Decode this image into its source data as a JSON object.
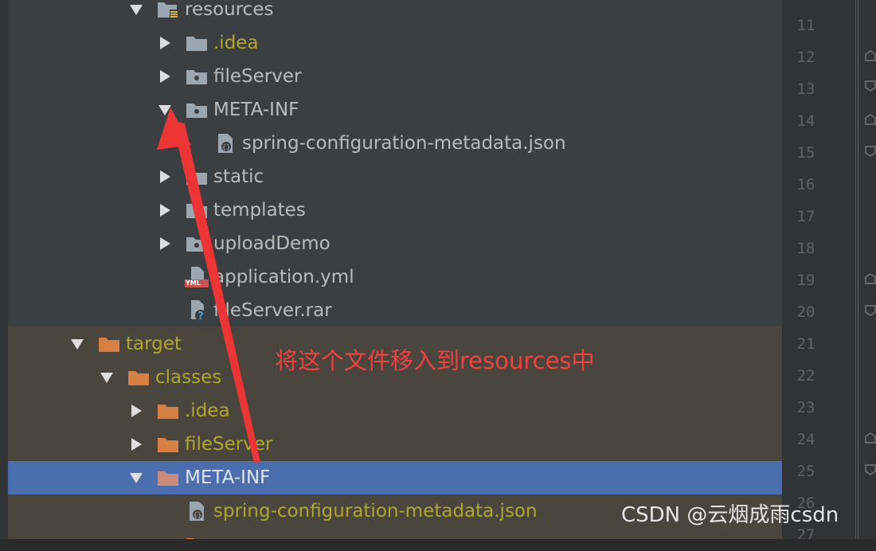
{
  "tree": {
    "items": [
      {
        "label": "resources",
        "color": "white",
        "expanded": true,
        "icon": "resources-folder-icon"
      },
      {
        "label": ".idea",
        "color": "yellow",
        "expanded": false,
        "icon": "folder-icon"
      },
      {
        "label": "fileServer",
        "color": "white",
        "expanded": false,
        "icon": "package-folder-icon"
      },
      {
        "label": "META-INF",
        "color": "white",
        "expanded": true,
        "icon": "package-folder-icon"
      },
      {
        "label": "spring-configuration-metadata.json",
        "color": "white",
        "icon": "json-file-icon"
      },
      {
        "label": "static",
        "color": "white",
        "expanded": false,
        "icon": "folder-icon"
      },
      {
        "label": "templates",
        "color": "white",
        "expanded": false,
        "icon": "folder-icon"
      },
      {
        "label": "uploadDemo",
        "color": "white",
        "expanded": false,
        "icon": "package-folder-icon"
      },
      {
        "label": "application.yml",
        "color": "white",
        "icon": "yml-file-icon",
        "icon_text": "YML"
      },
      {
        "label": "fileServer.rar",
        "color": "white",
        "icon": "unknown-file-icon"
      },
      {
        "label": "target",
        "color": "yellow",
        "expanded": true,
        "icon": "excluded-folder-icon"
      },
      {
        "label": "classes",
        "color": "yellow",
        "expanded": true,
        "icon": "excluded-folder-icon"
      },
      {
        "label": ".idea",
        "color": "yellow",
        "expanded": false,
        "icon": "excluded-folder-icon"
      },
      {
        "label": "fileServer",
        "color": "yellow",
        "expanded": false,
        "icon": "excluded-folder-icon"
      },
      {
        "label": "META-INF",
        "color": "white",
        "expanded": true,
        "icon": "excluded-folder-icon",
        "selected": true
      },
      {
        "label": "spring-configuration-metadata.json",
        "color": "yellow",
        "icon": "json-file-icon"
      }
    ]
  },
  "gutter": {
    "line_numbers": [
      "11",
      "12",
      "13",
      "14",
      "15",
      "16",
      "17",
      "18",
      "19",
      "20",
      "21",
      "22",
      "23",
      "24",
      "25",
      "26",
      "27"
    ]
  },
  "annotation": {
    "text": "将这个文件移入到resources中",
    "color": "#f04040"
  },
  "watermark": {
    "text": "CSDN @云烟成雨csdn"
  },
  "colors": {
    "panel": "#3c3f41",
    "excluded_bg": "#4a463e",
    "selection": "#4b6eaf",
    "yellow_text": "#b1a62d",
    "folder_gray": "#9aa7b0",
    "folder_orange": "#d57f42"
  }
}
